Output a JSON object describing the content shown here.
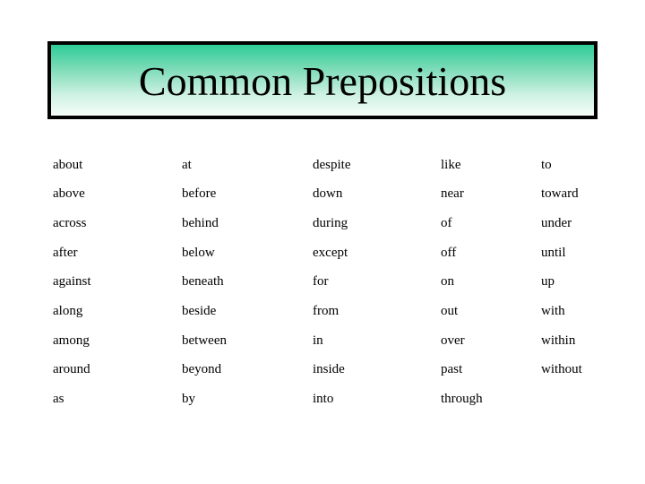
{
  "title": "Common Prepositions",
  "colors": {
    "gradient_top": "#2ecc98",
    "gradient_bottom": "#f6fdf9",
    "border": "#000000",
    "text": "#000000"
  },
  "table": {
    "rows": [
      [
        "about",
        "at",
        "despite",
        "like",
        "to"
      ],
      [
        "above",
        "before",
        "down",
        "near",
        "toward"
      ],
      [
        "across",
        "behind",
        "during",
        "of",
        "under"
      ],
      [
        "after",
        "below",
        "except",
        "off",
        "until"
      ],
      [
        "against",
        "beneath",
        "for",
        "on",
        "up"
      ],
      [
        "along",
        "beside",
        "from",
        "out",
        "with"
      ],
      [
        "among",
        "between",
        "in",
        "over",
        "within"
      ],
      [
        "around",
        "beyond",
        "inside",
        "past",
        "without"
      ],
      [
        "as",
        "by",
        "into",
        "through",
        ""
      ]
    ]
  }
}
